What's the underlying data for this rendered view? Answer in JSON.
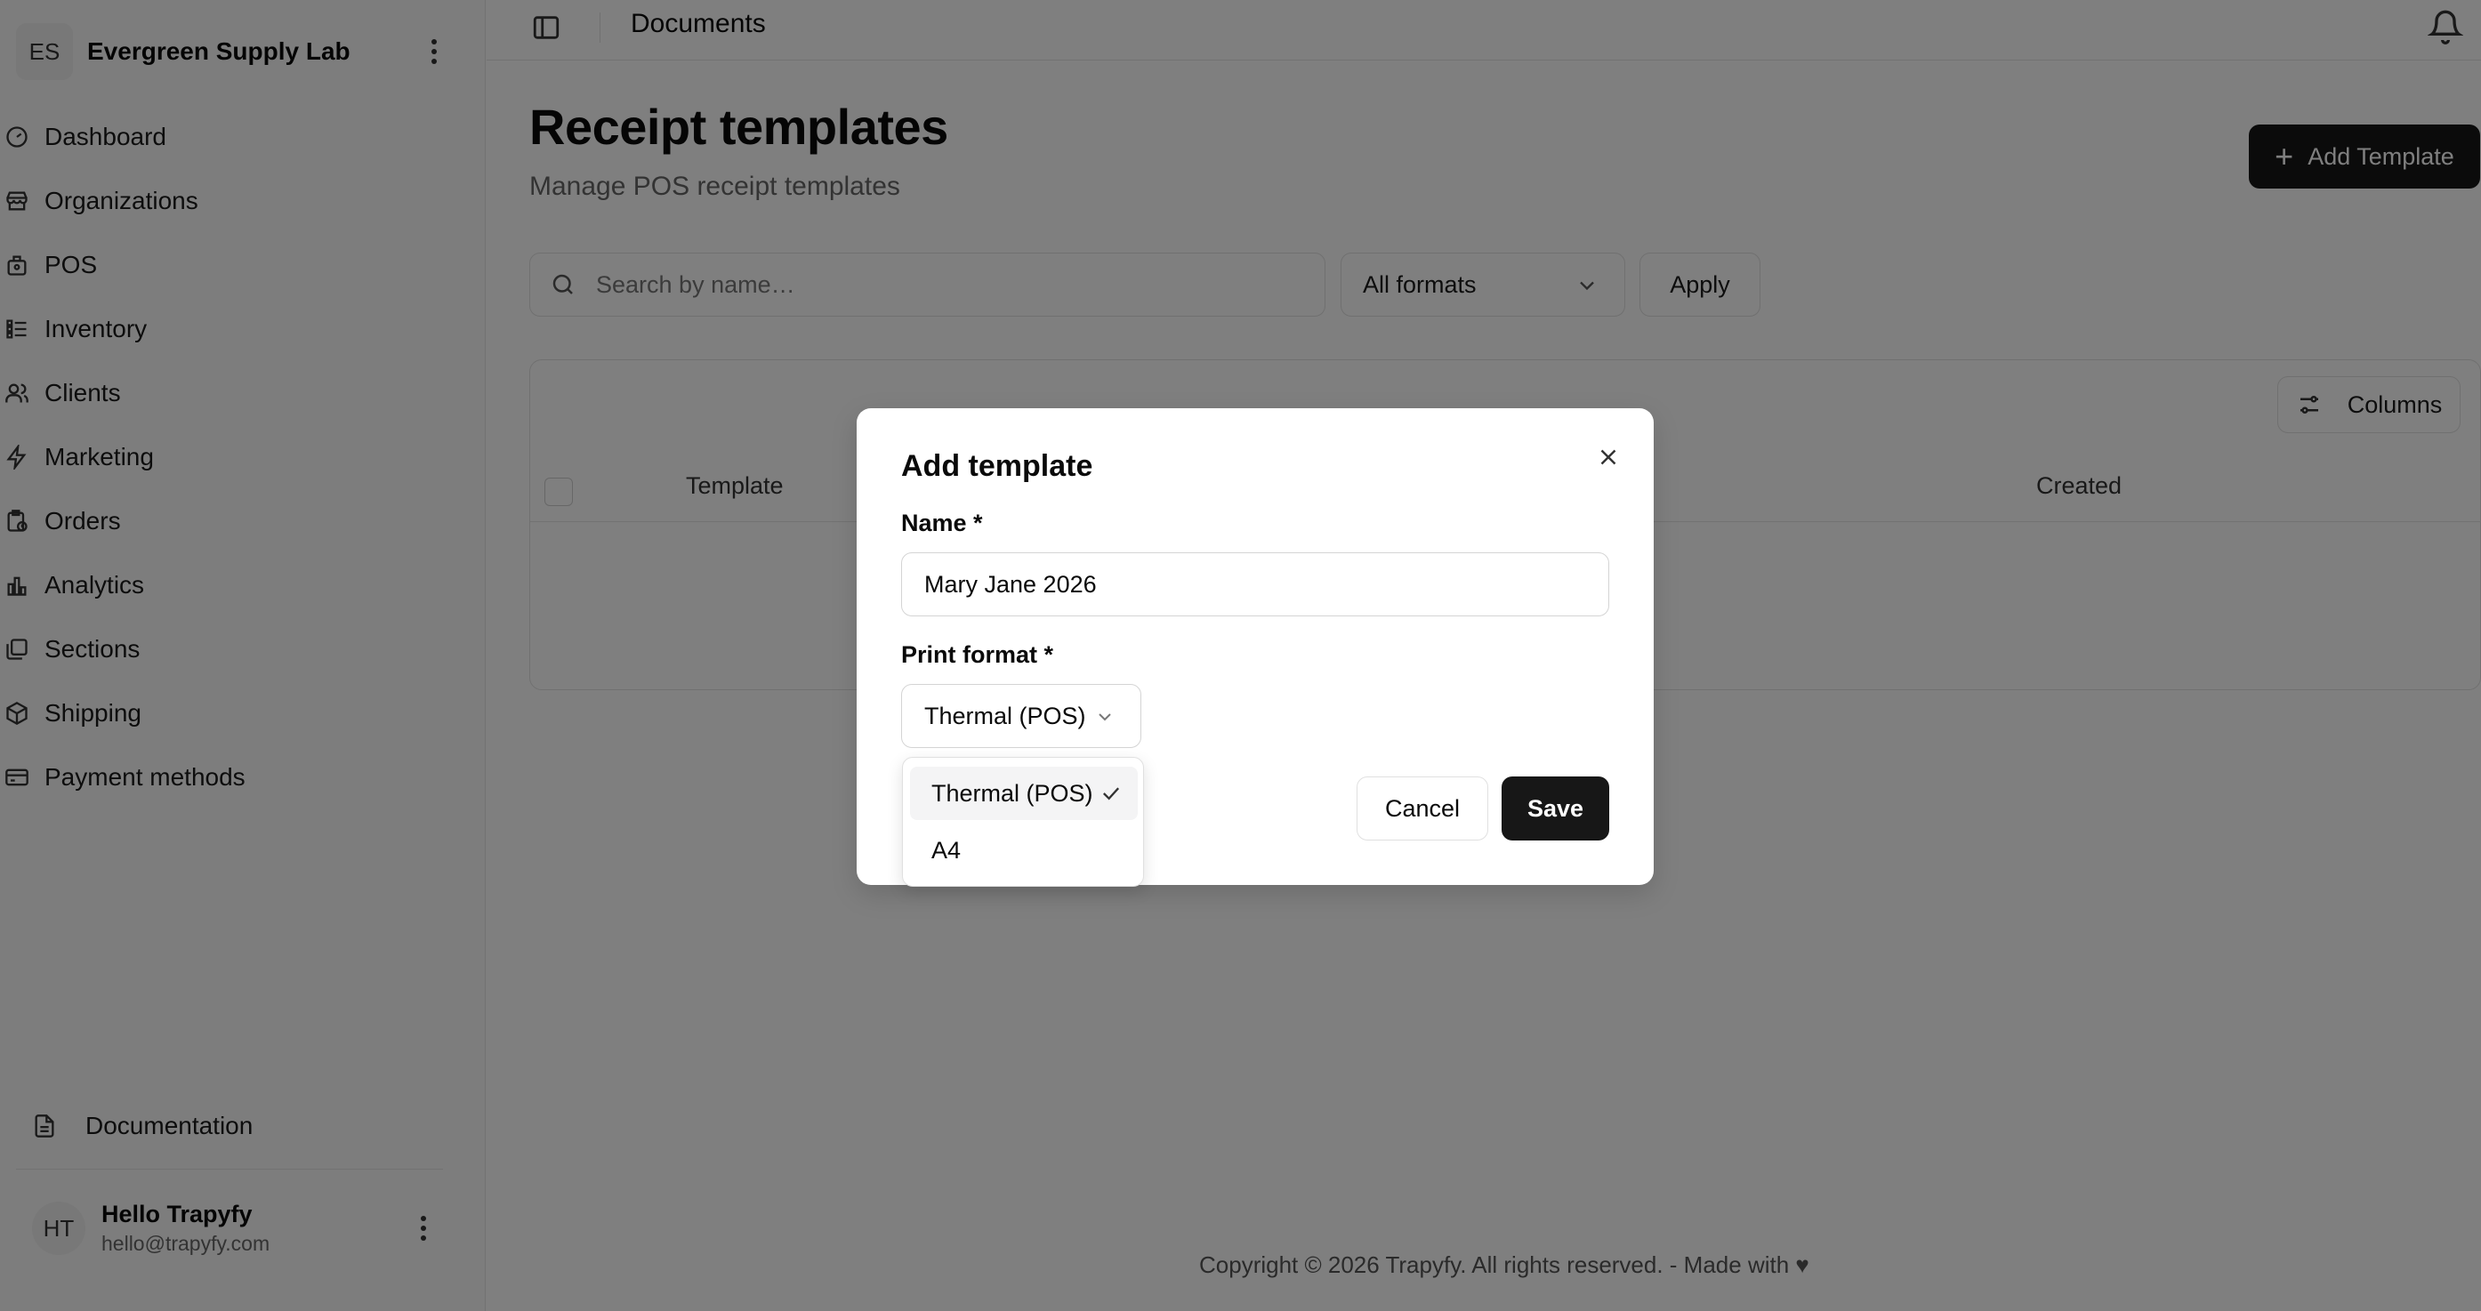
{
  "sidebar": {
    "org": {
      "initials": "ES",
      "name": "Evergreen Supply Lab"
    },
    "items": [
      {
        "label": "Dashboard",
        "icon": "gauge-icon"
      },
      {
        "label": "Organizations",
        "icon": "store-icon"
      },
      {
        "label": "POS",
        "icon": "cash-register-icon"
      },
      {
        "label": "Inventory",
        "icon": "list-icon"
      },
      {
        "label": "Clients",
        "icon": "users-icon"
      },
      {
        "label": "Marketing",
        "icon": "zap-icon"
      },
      {
        "label": "Orders",
        "icon": "clipboard-clock-icon"
      },
      {
        "label": "Analytics",
        "icon": "bar-chart-icon"
      },
      {
        "label": "Sections",
        "icon": "layers-icon"
      },
      {
        "label": "Shipping",
        "icon": "package-icon"
      },
      {
        "label": "Payment methods",
        "icon": "credit-card-icon"
      }
    ],
    "documentation": "Documentation",
    "user": {
      "initials": "HT",
      "name": "Hello Trapyfy",
      "email": "hello@trapyfy.com"
    }
  },
  "topbar": {
    "title": "Documents"
  },
  "page": {
    "title": "Receipt templates",
    "subtitle": "Manage POS receipt templates",
    "add_button": "Add Template"
  },
  "filters": {
    "search_placeholder": "Search by name…",
    "format_value": "All formats",
    "apply_label": "Apply"
  },
  "table": {
    "columns_button": "Columns",
    "headers": {
      "template": "Template",
      "created": "Created"
    }
  },
  "footer": {
    "text": "Copyright © 2026 Trapyfy. All rights reserved. - Made with ♥"
  },
  "dialog": {
    "title": "Add template",
    "name_label": "Name *",
    "name_value": "Mary Jane 2026",
    "format_label": "Print format *",
    "format_value": "Thermal (POS)",
    "cancel_label": "Cancel",
    "save_label": "Save",
    "options": [
      {
        "label": "Thermal (POS)",
        "selected": true
      },
      {
        "label": "A4",
        "selected": false
      }
    ]
  },
  "colors": {
    "primary_button": "#171717",
    "overlay": "rgba(0,0,0,0.5)"
  }
}
